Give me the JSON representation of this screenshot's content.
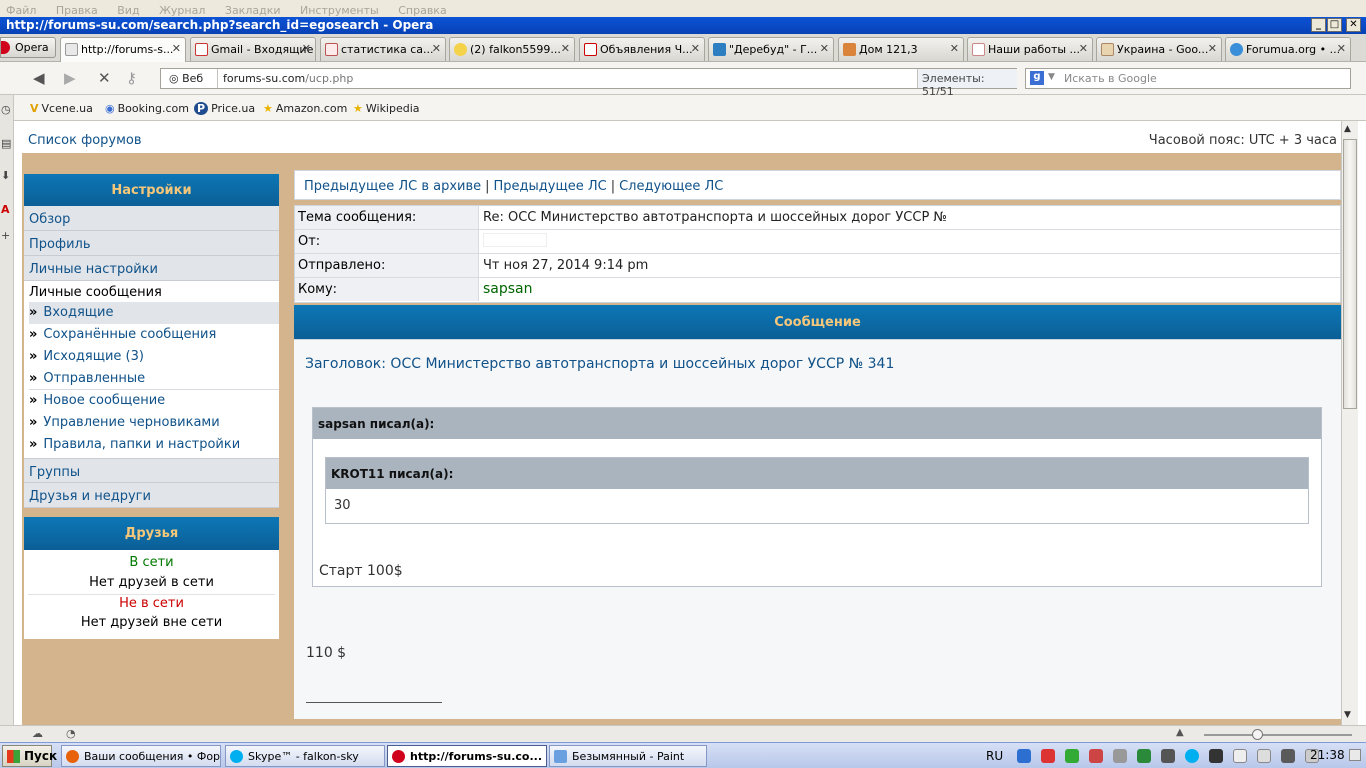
{
  "browser": {
    "menubar": [
      "Файл",
      "Правка",
      "Вид",
      "Журнал",
      "Закладки",
      "Инструменты",
      "Справка"
    ],
    "title": "http://forums-su.com/search.php?search_id=egosearch - Opera",
    "opera_label": "Opera",
    "tabs": [
      {
        "label": "http://forums-s..."
      },
      {
        "label": "Gmail - Входящие"
      },
      {
        "label": "статистика са..."
      },
      {
        "label": "(2) falkon5599..."
      },
      {
        "label": "Объявления Ч..."
      },
      {
        "label": "\"Деребуд\" - Г..."
      },
      {
        "label": "Дом 121,3"
      },
      {
        "label": "Наши работы ..."
      },
      {
        "label": "Украина - Goo..."
      },
      {
        "label": "Forumua.org • ..."
      }
    ],
    "address": {
      "web_label": "Веб",
      "domain": "forums-su.com",
      "path": "/ucp.php",
      "elements_label": "Элементы:",
      "elements_value": "51/51"
    },
    "search_placeholder": "Искать в Google",
    "bookmarks": [
      "Vcene.ua",
      "Booking.com",
      "Price.ua",
      "Amazon.com",
      "Wikipedia"
    ]
  },
  "page": {
    "forum_index": "Список форумов",
    "timezone": "Часовой пояс: UTC + 3 часа",
    "settings_head": "Настройки",
    "nav_top": [
      "Обзор",
      "Профиль",
      "Личные настройки"
    ],
    "pm_title": "Личные сообщения",
    "pm_items": [
      "Входящие",
      "Сохранённые сообщения",
      "Исходящие (3)",
      "Отправленные",
      "Новое сообщение",
      "Управление черновиками",
      "Правила, папки и настройки"
    ],
    "nav_bottom": [
      "Группы",
      "Друзья и недруги"
    ],
    "friends_head": "Друзья",
    "online_label": "В сети",
    "online_none": "Нет друзей в сети",
    "offline_label": "Не в сети",
    "offline_none": "Нет друзей вне сети",
    "pm_nav": {
      "prev_archive": "Предыдущее ЛС в архиве",
      "prev": "Предыдущее ЛС",
      "next": "Следующее ЛС"
    },
    "header": {
      "subject_label": "Тема сообщения:",
      "subject_value": "Re: ОСС Министерство автотранспорта и шоссейных дорог УССР №",
      "from_label": "От:",
      "sent_label": "Отправлено:",
      "sent_value": "Чт ноя 27, 2014 9:14 pm",
      "to_label": "Кому:",
      "to_value": "sapsan"
    },
    "message_head": "Сообщение",
    "message": {
      "subject_line": "Заголовок: ОСС Министерство автотранспорта и шоссейных дорог УССР № 341",
      "quote_outer_author": "sapsan писал(а):",
      "quote_inner_author": "KROT11 писал(а):",
      "quote_inner_value": "30",
      "quote_outer_text": "Старт 100$",
      "reply_text": "110 $"
    }
  },
  "taskbar": {
    "start": "Пуск",
    "items": [
      {
        "label": "Ваши сообщения • Фор..."
      },
      {
        "label": "Skype™ - falkon-sky"
      },
      {
        "label": "http://forums-su.co..."
      },
      {
        "label": "Безымянный - Paint"
      }
    ],
    "lang": "RU",
    "clock": "21:38"
  },
  "colors": {
    "link": "#105289",
    "page_bg": "#d4b48c",
    "header_blue": "#0b6aa8",
    "header_text": "#f5c77a",
    "online": "#007a00",
    "offline": "#cc0000"
  }
}
